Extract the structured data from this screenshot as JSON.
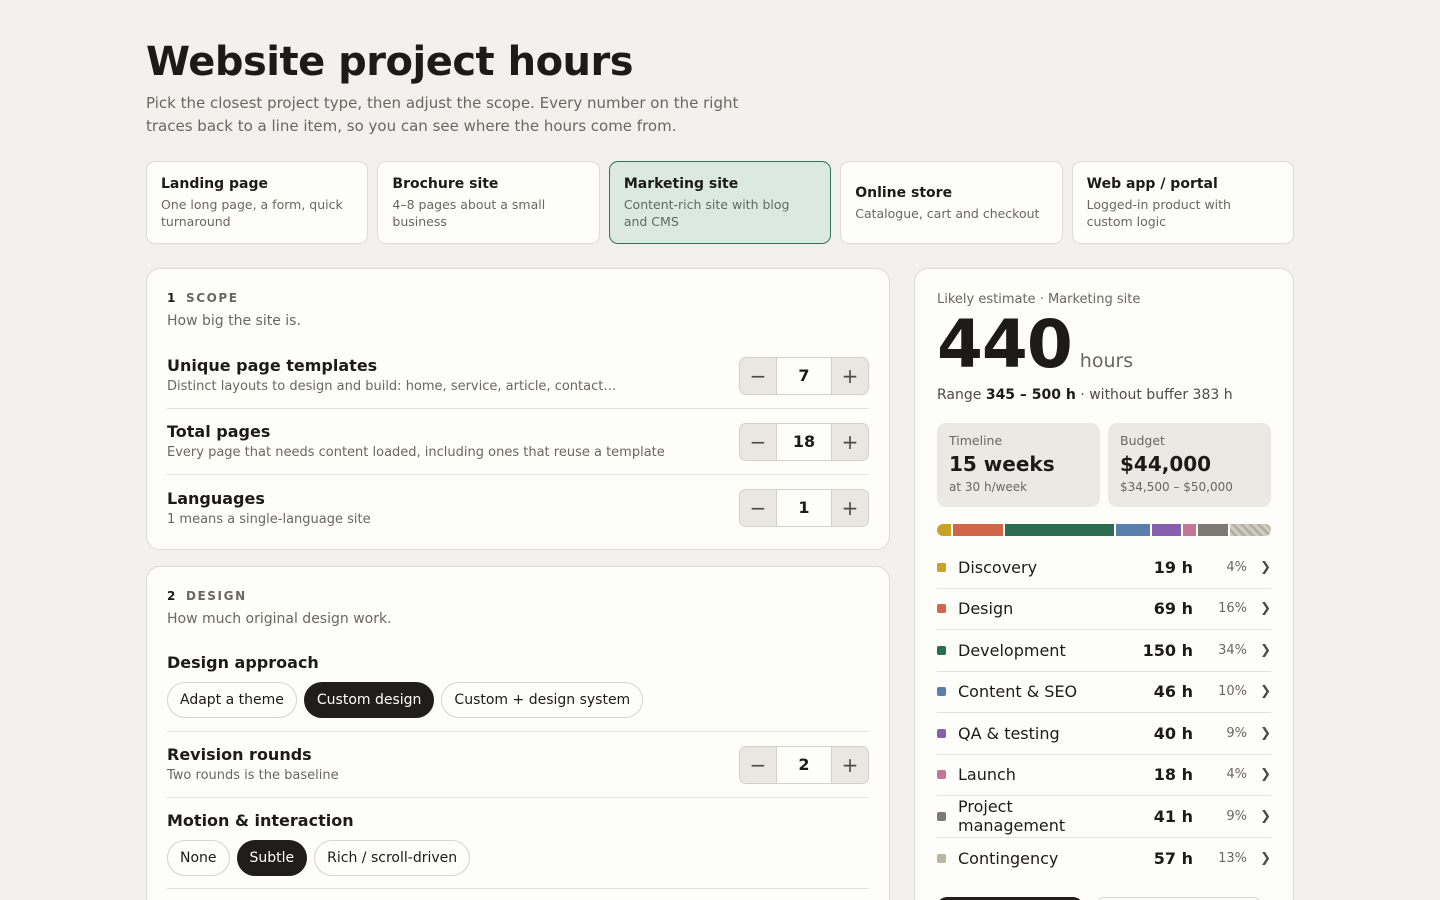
{
  "page": {
    "title": "Website project hours",
    "subtitle": "Pick the closest project type, then adjust the scope. Every number on the right traces back to a line item, so you can see where the hours come from."
  },
  "project_types": [
    {
      "name": "Landing page",
      "desc": "One long page, a form, quick turnaround"
    },
    {
      "name": "Brochure site",
      "desc": "4–8 pages about a small business"
    },
    {
      "name": "Marketing site",
      "desc": "Content-rich site with blog and CMS"
    },
    {
      "name": "Online store",
      "desc": "Catalogue, cart and checkout"
    },
    {
      "name": "Web app / portal",
      "desc": "Logged-in product with custom logic"
    }
  ],
  "scope": {
    "number": "1",
    "heading": "SCOPE",
    "desc": "How big the site is.",
    "rows": [
      {
        "title": "Unique page templates",
        "desc": "Distinct layouts to design and build: home, service, article, contact…",
        "value": "7"
      },
      {
        "title": "Total pages",
        "desc": "Every page that needs content loaded, including ones that reuse a template",
        "value": "18"
      },
      {
        "title": "Languages",
        "desc": "1 means a single-language site",
        "value": "1"
      }
    ]
  },
  "design": {
    "number": "2",
    "heading": "DESIGN",
    "desc": "How much original design work.",
    "approach_title": "Design approach",
    "approach_options": [
      "Adapt a theme",
      "Custom design",
      "Custom + design system"
    ],
    "revision_title": "Revision rounds",
    "revision_desc": "Two rounds is the baseline",
    "revision_value": "2",
    "motion_title": "Motion & interaction",
    "motion_options": [
      "None",
      "Subtle",
      "Rich / scroll-driven"
    ]
  },
  "stepper": {
    "minus": "−",
    "plus": "+"
  },
  "summary": {
    "label": "Likely estimate · Marketing site",
    "hours": "440",
    "unit": "hours",
    "range_prefix": "Range",
    "range_value": "345 – 500 h",
    "range_suffix": "· without buffer 383 h",
    "timeline_label": "Timeline",
    "timeline_value": "15 weeks",
    "timeline_sub": "at 30 h/week",
    "budget_label": "Budget",
    "budget_value": "$44,000",
    "budget_sub": "$34,500 – $50,000",
    "chevron": "❯",
    "categories": [
      {
        "name": "Discovery",
        "hours": "19 h",
        "pct": "4%",
        "color": "#c9a227"
      },
      {
        "name": "Design",
        "hours": "69 h",
        "pct": "16%",
        "color": "#d0654a"
      },
      {
        "name": "Development",
        "hours": "150 h",
        "pct": "34%",
        "color": "#2e6b53"
      },
      {
        "name": "Content & SEO",
        "hours": "46 h",
        "pct": "10%",
        "color": "#5a7eab"
      },
      {
        "name": "QA & testing",
        "hours": "40 h",
        "pct": "9%",
        "color": "#8660ad"
      },
      {
        "name": "Launch",
        "hours": "18 h",
        "pct": "4%",
        "color": "#c27792"
      },
      {
        "name": "Project management",
        "hours": "41 h",
        "pct": "9%",
        "color": "#7c7a73"
      },
      {
        "name": "Contingency",
        "hours": "57 h",
        "pct": "13%",
        "color": "#b9b6a9"
      }
    ]
  }
}
